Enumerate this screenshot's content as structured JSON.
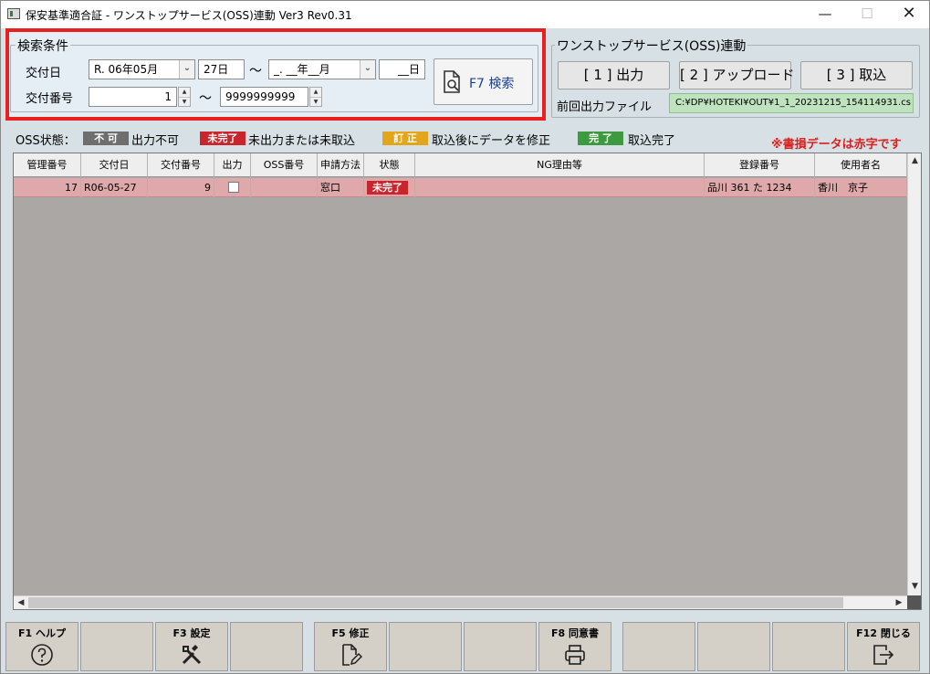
{
  "window": {
    "title": "保安基準適合証 - ワンストップサービス(OSS)連動 Ver3 Rev0.31",
    "minimize": "—",
    "maximize": "☐",
    "close": "✕"
  },
  "search": {
    "group_label": "検索条件",
    "issue_date_label": "交付日",
    "issue_date_from_era_month": "R. 06年05月",
    "issue_date_from_day": "27日",
    "tilde": "～",
    "issue_date_to_era_month": "_. __年__月",
    "issue_date_to_day": "__日",
    "issue_number_label": "交付番号",
    "issue_number_from": "1",
    "issue_number_to": "9999999999",
    "search_button": "F7 検索"
  },
  "oss": {
    "group_label": "ワンストップサービス(OSS)連動",
    "output_button": "[ 1 ] 出力",
    "upload_button": "[ 2 ] アップロード",
    "import_button": "[ 3 ] 取込",
    "previous_file_label": "前回出力ファイル",
    "previous_file_value": "C:¥DP¥HOTEKI¥OUT¥1_1_20231215_154114931.cs"
  },
  "legend": {
    "title": "OSS状態：",
    "items": [
      {
        "badge": "不 可",
        "text": "出力不可",
        "color": "#6e6e6e"
      },
      {
        "badge": "未完了",
        "text": "未出力または未取込",
        "color": "#c8262c"
      },
      {
        "badge": "訂 正",
        "text": "取込後にデータを修正",
        "color": "#e3a51c"
      },
      {
        "badge": "完 了",
        "text": "取込完了",
        "color": "#3e9a3e"
      }
    ],
    "note": "※書損データは赤字です"
  },
  "grid": {
    "columns": [
      "管理番号",
      "交付日",
      "交付番号",
      "出力",
      "OSS番号",
      "申請方法",
      "状態",
      "NG理由等",
      "登録番号",
      "使用者名"
    ],
    "rows": [
      {
        "control_no": "17",
        "issue_date": "R06-05-27",
        "issue_no": "9",
        "output": "",
        "oss_no": "",
        "method": "窓口",
        "status": "未完了",
        "ng_reason": "",
        "reg_no": "品川 361 た 1234",
        "user_name": "香川　京子"
      }
    ]
  },
  "fkeys": [
    {
      "label": "F1 ヘルプ",
      "icon": "help-icon"
    },
    {
      "label": "",
      "icon": ""
    },
    {
      "label": "F3 設定",
      "icon": "tools-icon"
    },
    {
      "label": "",
      "icon": ""
    },
    {
      "label": "F5 修正",
      "icon": "edit-document-icon"
    },
    {
      "label": "",
      "icon": ""
    },
    {
      "label": "",
      "icon": ""
    },
    {
      "label": "F8 同意書",
      "icon": "printer-icon"
    },
    {
      "label": "",
      "icon": ""
    },
    {
      "label": "",
      "icon": ""
    },
    {
      "label": "",
      "icon": ""
    },
    {
      "label": "F12 閉じる",
      "icon": "exit-icon"
    }
  ]
}
